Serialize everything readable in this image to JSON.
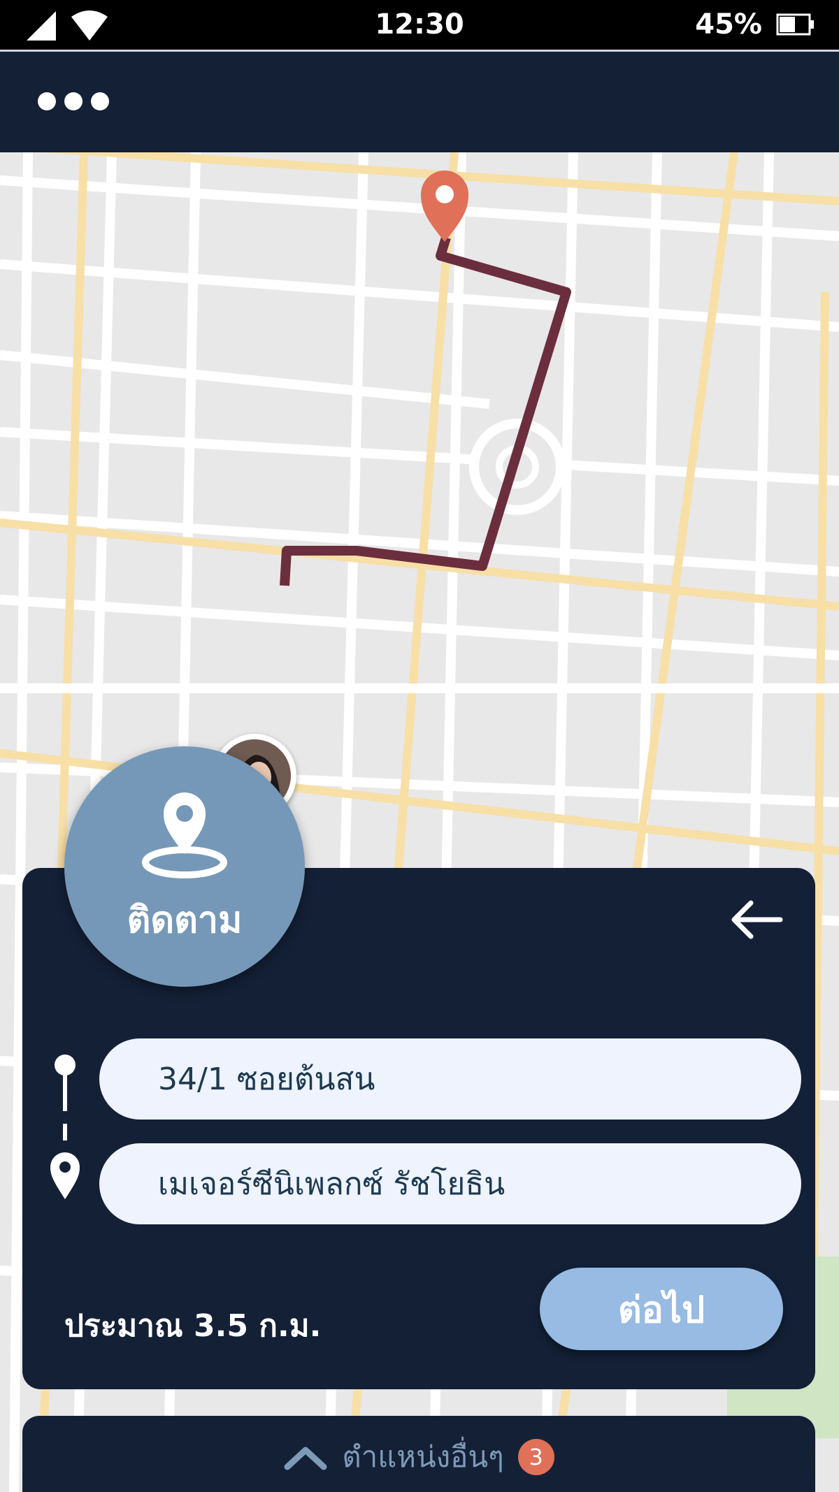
{
  "status_bar": {
    "time": "12:30",
    "battery": "45%",
    "icons": [
      "cellular-signal-icon",
      "wifi-icon",
      "battery-icon"
    ]
  },
  "header": {
    "menu_icon": "more-dots-icon"
  },
  "map": {
    "destination_marker": "map-pin-icon",
    "route_color": "#6b2e3e",
    "user_avatar": "user-avatar",
    "current_location": "current-location-dot"
  },
  "follow": {
    "icon": "location-target-icon",
    "label": "ติดตาม"
  },
  "route_card": {
    "back_icon": "arrow-left-icon",
    "origin": "34/1 ซอยต้นสน",
    "destination": "เมเจอร์ซีนิเพลกซ์ รัชโยธิน",
    "distance": "ประมาณ 3.5 ก.ม.",
    "next_label": "ต่อไป"
  },
  "other_locations": {
    "icon": "chevron-up-icon",
    "label": "ตำแหน่งอื่นๆ",
    "count": "3"
  },
  "colors": {
    "header_bg": "#142036",
    "card_bg": "#142036",
    "follow_bg": "#7598b8",
    "next_button_bg": "#97bbe3",
    "badge_bg": "#e07058",
    "pin_color": "#e07058"
  }
}
